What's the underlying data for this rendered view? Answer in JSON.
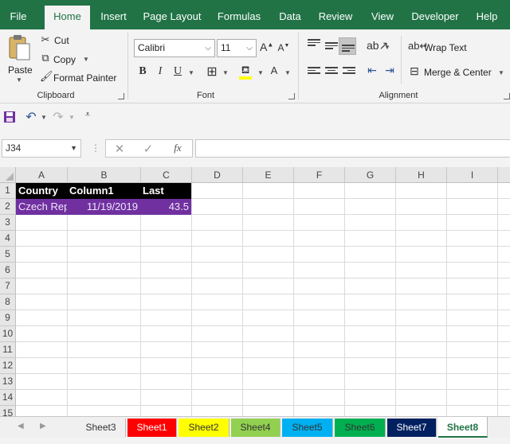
{
  "menu": {
    "tabs": [
      "File",
      "Home",
      "Insert",
      "Page Layout",
      "Formulas",
      "Data",
      "Review",
      "View",
      "Developer",
      "Help"
    ],
    "active": "Home"
  },
  "clipboard": {
    "paste": "Paste",
    "cut": "Cut",
    "copy": "Copy",
    "format_painter": "Format Painter",
    "label": "Clipboard"
  },
  "font": {
    "name": "Calibri",
    "size": "11",
    "bold": "B",
    "italic": "I",
    "underline": "U",
    "grow": "A",
    "shrink": "A",
    "color_letter": "A",
    "label": "Font"
  },
  "alignment": {
    "wrap_text": "Wrap Text",
    "merge_center": "Merge & Center",
    "label": "Alignment"
  },
  "formula_bar": {
    "name_box": "J34",
    "fx": "fx",
    "formula": ""
  },
  "grid": {
    "columns": [
      "A",
      "B",
      "C",
      "D",
      "E",
      "F",
      "G",
      "H",
      "I"
    ],
    "rows": [
      "1",
      "2",
      "3",
      "4",
      "5",
      "6",
      "7",
      "8",
      "9",
      "10",
      "11",
      "12",
      "13",
      "14",
      "15"
    ],
    "header_row": [
      "Country",
      "Column1",
      "Last"
    ],
    "data_row": [
      "Czech Rep",
      "11/19/2019",
      "43.5"
    ]
  },
  "sheets": [
    {
      "name": "Sheet3",
      "color": "#f0f0f0",
      "text": "#333333"
    },
    {
      "name": "Sheet1",
      "color": "#ff0000",
      "text": "#ffffff"
    },
    {
      "name": "Sheet2",
      "color": "#ffff00",
      "text": "#333333"
    },
    {
      "name": "Sheet4",
      "color": "#92d050",
      "text": "#333333"
    },
    {
      "name": "Sheet5",
      "color": "#00b0f0",
      "text": "#333333"
    },
    {
      "name": "Sheet6",
      "color": "#00b050",
      "text": "#333333"
    },
    {
      "name": "Sheet7",
      "color": "#002060",
      "text": "#ffffff"
    },
    {
      "name": "Sheet8",
      "color": "#ffffff",
      "text": "#217346"
    }
  ],
  "colors": {
    "brand": "#217346",
    "header_fill": "#000000",
    "data_fill": "#7030a0"
  }
}
